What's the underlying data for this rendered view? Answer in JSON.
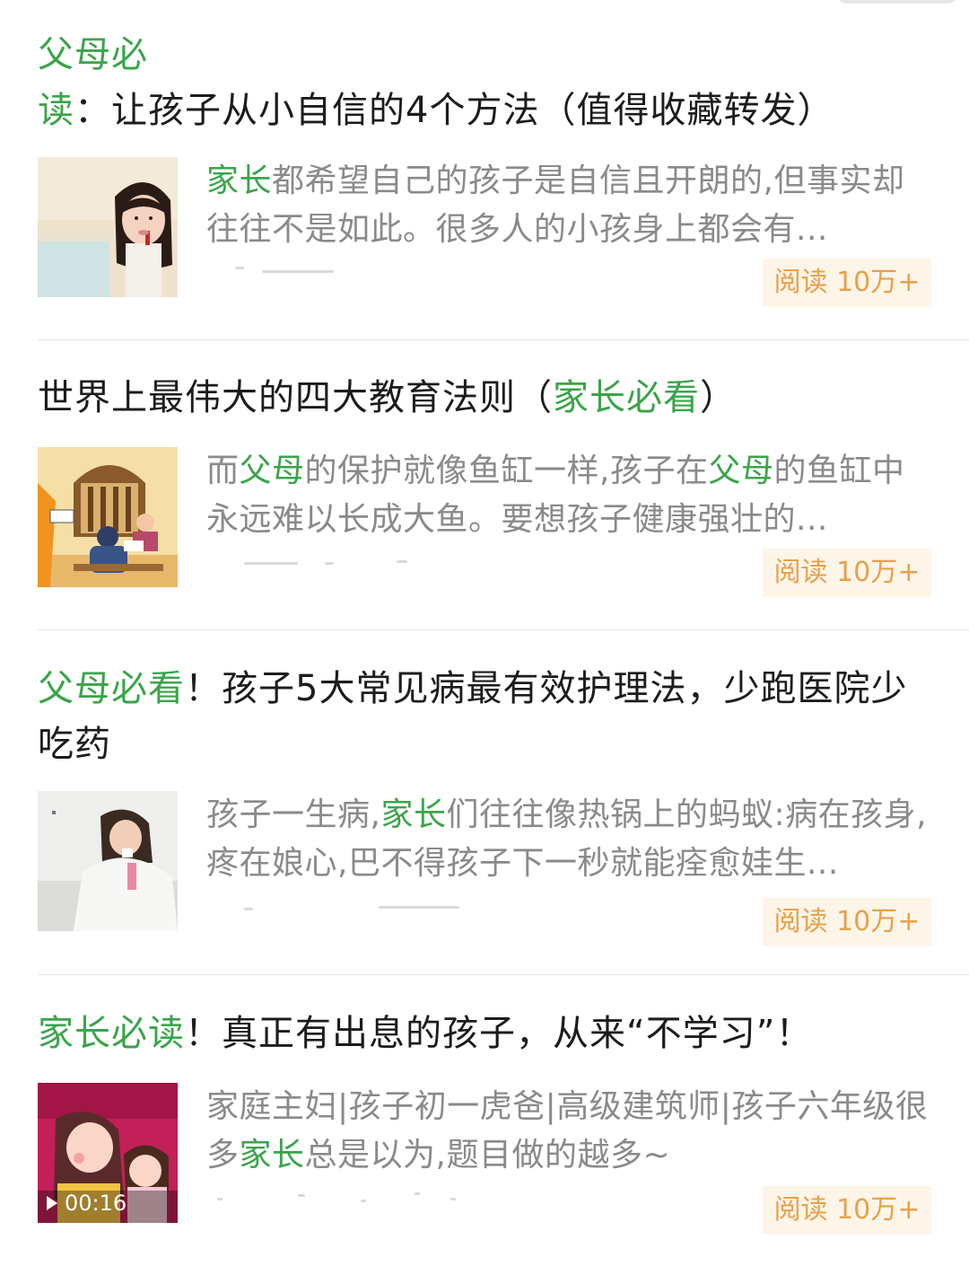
{
  "articles": [
    {
      "title_highlight": "父母必读",
      "title_rest": "：让孩子从小自信的4个方法（值得收藏转发）",
      "snippet_hl1": "家长",
      "snippet_rest1": "都希望自己的孩子是自信且开朗的,但事实却往往不是如此。很多人的小孩身上都会有...",
      "read_label": "阅读 10万+",
      "thumb_icon": "girl-portrait-thumbnail"
    },
    {
      "title_pre": "世界上最伟大的四大教育法则（",
      "title_highlight": "家长必看",
      "title_post": "）",
      "snippet_pre": "而",
      "snippet_hl1": "父母",
      "snippet_mid": "的保护就像鱼缸一样,孩子在",
      "snippet_hl2": "父母",
      "snippet_rest": "的鱼缸中永远难以长成大鱼。要想孩子健康强壮的...",
      "read_label": "阅读 10万+",
      "thumb_icon": "classroom-illustration-thumbnail"
    },
    {
      "title_highlight": "父母必看",
      "title_rest": "！孩子5大常见病最有效护理法，少跑医院少吃药",
      "snippet_pre": "孩子一生病,",
      "snippet_hl1": "家长",
      "snippet_rest": "们往往像热锅上的蚂蚁:病在孩身,疼在娘心,巴不得孩子下一秒就能痊愈娃生...",
      "read_label": "阅读 10万+",
      "thumb_icon": "sick-child-thumbnail"
    },
    {
      "title_highlight": "家长必读",
      "title_rest": "！真正有出息的孩子，从来“不学习”！",
      "snippet_pre": "家庭主妇|孩子初一虎爸|高级建筑师|孩子六年级很多",
      "snippet_hl1": "家长",
      "snippet_rest": "总是以为,题目做的越多~",
      "read_label": "阅读 10万+",
      "video_duration": "00:16",
      "thumb_icon": "mother-daughter-video-thumbnail"
    }
  ],
  "colors": {
    "highlight": "#3aa54a",
    "title": "#1c1c1c",
    "snippet": "#8a8a8a",
    "badge_bg": "#fdf5e8",
    "badge_text": "#e9a04a"
  }
}
